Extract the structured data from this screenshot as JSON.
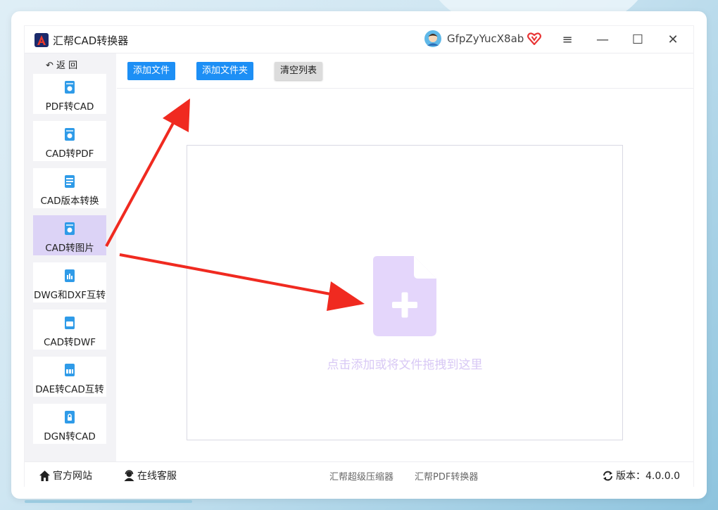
{
  "app": {
    "title": "汇帮CAD转换器"
  },
  "user": {
    "name": "GfpZyYucX8ab"
  },
  "window_controls": {
    "menu": "≡",
    "minimize": "—",
    "maximize": "☐",
    "close": "✕"
  },
  "sidebar": {
    "back_label": "返 回",
    "items": [
      {
        "label": "PDF转CAD"
      },
      {
        "label": "CAD转PDF"
      },
      {
        "label": "CAD版本转换"
      },
      {
        "label": "CAD转图片",
        "active": true
      },
      {
        "label": "DWG和DXF互转"
      },
      {
        "label": "CAD转DWF"
      },
      {
        "label": "DAE转CAD互转"
      },
      {
        "label": "DGN转CAD"
      }
    ]
  },
  "toolbar": {
    "add_file": "添加文件",
    "add_folder": "添加文件夹",
    "clear_list": "清空列表"
  },
  "dropzone": {
    "hint": "点击添加或将文件拖拽到这里"
  },
  "footer": {
    "website": "官方网站",
    "support": "在线客服",
    "link1": "汇帮超级压缩器",
    "link2": "汇帮PDF转换器",
    "version": "版本：4.0.0.0"
  },
  "colors": {
    "accent": "#1d8ff5",
    "active_nav": "#dcd3f6",
    "drop_icon": "#e4d6fb",
    "arrow": "#f02a20",
    "vip": "#e83434"
  }
}
